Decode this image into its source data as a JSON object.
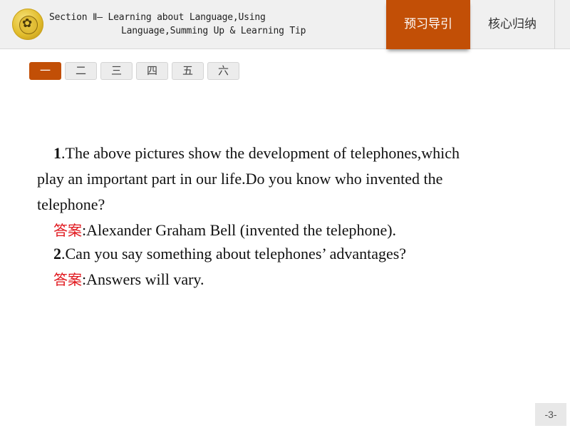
{
  "header": {
    "logo_icon": "school-emblem-icon",
    "title_line1": "Section Ⅱ— Learning about Language,Using",
    "title_line2": "Language,Summing Up & Learning Tip",
    "tabs": [
      {
        "label": "预习导引",
        "active": true
      },
      {
        "label": "核心归纳",
        "active": false
      }
    ]
  },
  "section_nav": {
    "items": [
      {
        "label": "一",
        "active": true
      },
      {
        "label": "二",
        "active": false
      },
      {
        "label": "三",
        "active": false
      },
      {
        "label": "四",
        "active": false
      },
      {
        "label": "五",
        "active": false
      },
      {
        "label": "六",
        "active": false
      }
    ]
  },
  "content": {
    "q1_number": "1",
    "q1_text_line1": ".The above pictures show the development of telephones,which",
    "q1_text_line2": "play an important part in our life.Do you know who invented the",
    "q1_text_line3": "telephone?",
    "answer_label": "答案",
    "a1_text": ":Alexander  Graham Bell (invented the telephone).",
    "q2_number": "2",
    "q2_text": ".Can you say something  about telephones’   advantages?",
    "a2_text": ":Answers  will  vary."
  },
  "colors": {
    "accent": "#c24f06",
    "answer_label": "#e0141a"
  },
  "footer": {
    "page_number": "-3-"
  }
}
